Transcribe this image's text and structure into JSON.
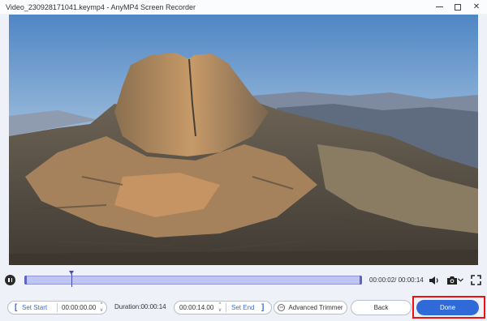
{
  "window": {
    "title": "Video_230928171041.keymp4  -  AnyMP4 Screen Recorder",
    "minimize_icon": "minimize-icon",
    "maximize_icon": "maximize-icon",
    "close_icon": "close-icon",
    "close_glyph": "✕"
  },
  "video": {
    "content": "mountain-landscape"
  },
  "playback": {
    "pause_icon": "pause-icon",
    "timecode": "00:00:02/ 00:00:14",
    "progress": 0.14,
    "volume_icon": "volume-icon",
    "camera_icon": "camera-icon",
    "camera_dropdown_icon": "chevron-down-icon",
    "fullscreen_icon": "fullscreen-icon"
  },
  "trim": {
    "set_start_label": "Set Start",
    "start_time": "00:00:00.00",
    "duration_label": "Duration:00:00:14",
    "end_time": "00:00:14.00",
    "set_end_label": "Set End",
    "advanced_trimmer_label": "Advanced Trimmer",
    "bracket_open": "[",
    "bracket_close": "]",
    "stepper_up": "^",
    "stepper_down": "v"
  },
  "actions": {
    "back_label": "Back",
    "done_label": "Done"
  },
  "colors": {
    "accent": "#2f6ad8",
    "highlight_outline": "#ee1111",
    "timeline_fill": "#bfc4f0"
  }
}
